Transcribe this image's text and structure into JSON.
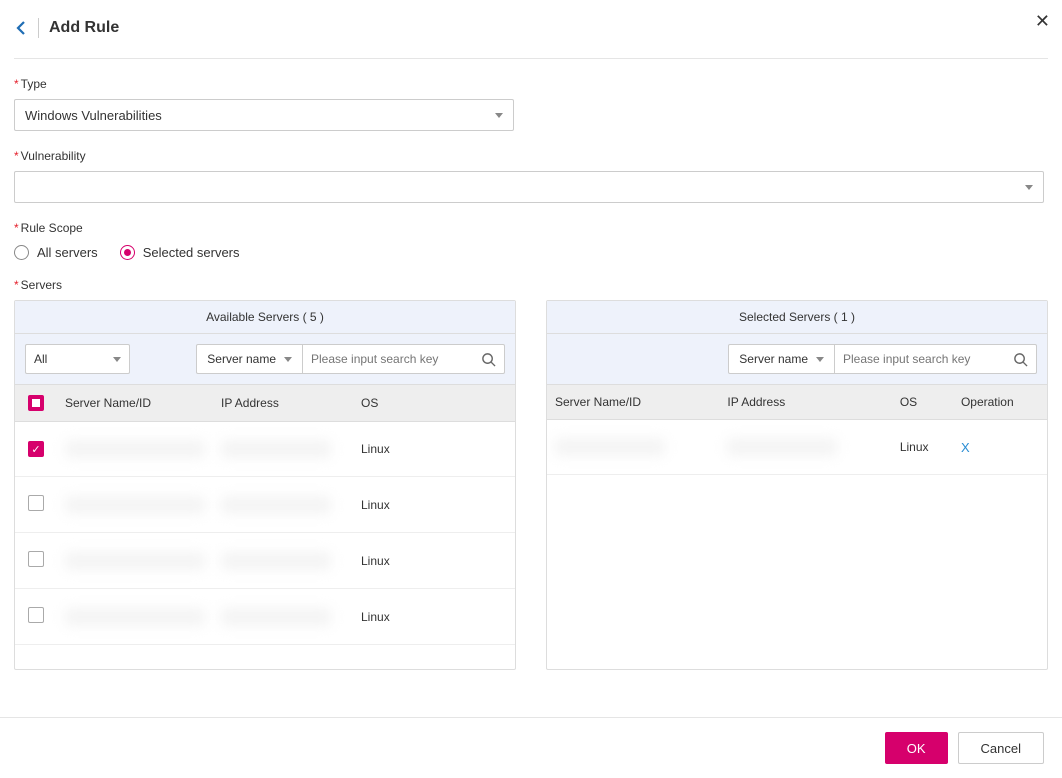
{
  "header": {
    "title": "Add Rule"
  },
  "fields": {
    "type_label": "Type",
    "type_value": "Windows Vulnerabilities",
    "vuln_label": "Vulnerability",
    "vuln_value": "",
    "scope_label": "Rule Scope",
    "scope_all": "All servers",
    "scope_selected": "Selected servers",
    "servers_label": "Servers"
  },
  "available": {
    "title": "Available Servers ( 5 )",
    "filter_all": "All",
    "search_mode": "Server name",
    "search_placeholder": "Please input search key",
    "cols": {
      "name": "Server Name/ID",
      "ip": "IP Address",
      "os": "OS"
    },
    "rows": [
      {
        "checked": true,
        "os": "Linux"
      },
      {
        "checked": false,
        "os": "Linux"
      },
      {
        "checked": false,
        "os": "Linux"
      },
      {
        "checked": false,
        "os": "Linux"
      }
    ]
  },
  "selected": {
    "title": "Selected Servers ( 1 )",
    "search_mode": "Server name",
    "search_placeholder": "Please input search key",
    "cols": {
      "name": "Server Name/ID",
      "ip": "IP Address",
      "os": "OS",
      "op": "Operation"
    },
    "rows": [
      {
        "os": "Linux",
        "op": "X"
      }
    ]
  },
  "footer": {
    "ok": "OK",
    "cancel": "Cancel"
  }
}
